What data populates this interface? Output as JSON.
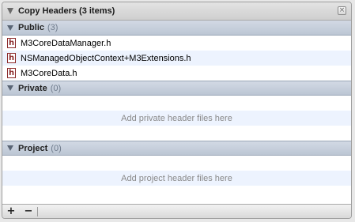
{
  "panel": {
    "title": "Copy Headers (3 items)",
    "close_glyph": "×"
  },
  "sections": {
    "public": {
      "title": "Public",
      "count": "(3)",
      "files": [
        {
          "icon": "h",
          "name": "M3CoreDataManager.h"
        },
        {
          "icon": "h",
          "name": "NSManagedObjectContext+M3Extensions.h"
        },
        {
          "icon": "h",
          "name": "M3CoreData.h"
        }
      ]
    },
    "private": {
      "title": "Private",
      "count": "(0)",
      "placeholder": "Add private header files here"
    },
    "project": {
      "title": "Project",
      "count": "(0)",
      "placeholder": "Add project header files here"
    }
  },
  "footer": {
    "add_label": "+",
    "remove_label": "−"
  },
  "icons": {
    "disclosure": "disclosure-triangle-icon",
    "header_file": "header-file-icon",
    "close": "close-icon"
  }
}
